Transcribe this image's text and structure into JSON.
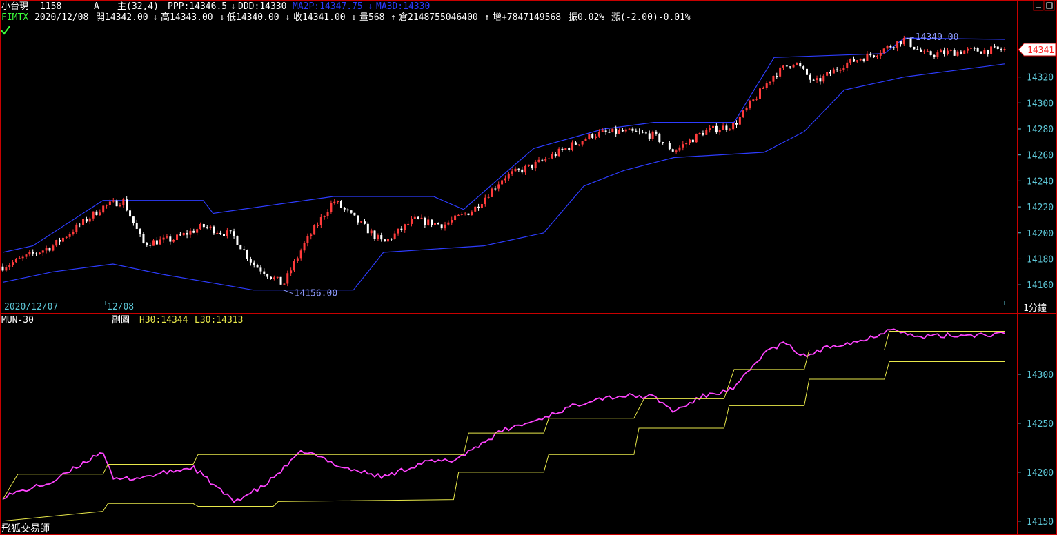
{
  "header": {
    "name": "小台現",
    "time": "1158",
    "flag": "A",
    "main_params": "主(32,4)",
    "ppp": "PPP:14346.5",
    "ppp_arrow": "↓",
    "ddd": "DDD:14330",
    "ma2p": "MA2P:14347.75",
    "ma2p_arrow": "↓",
    "ma3d": "MA3D:14330",
    "symbol": "FIMTX",
    "date": "2020/12/08",
    "open": "開14342.00",
    "open_arrow": "↓",
    "high": "高14343.00",
    "high_arrow": "↓",
    "low": "低14340.00",
    "low_arrow": "↓",
    "close": "收14341.00",
    "close_arrow": "↓",
    "volume": "量568",
    "volume_arrow": "↑",
    "oi": "倉2148755046400",
    "oi_arrow": "↑",
    "oi_change": "增+7847149568",
    "amplitude": "振0.02%",
    "change": "漲(-2.00)-0.01%"
  },
  "price_tag": "14341",
  "timeline": {
    "left_date": "2020/12/07",
    "mid_date": "12/08",
    "period": "1分鐘"
  },
  "sub_header": {
    "name": "MUN-30",
    "label": "副圖",
    "h30": "H30:14344",
    "l30": "L30:14313"
  },
  "watermark": "飛狐交易師",
  "colors": {
    "up_candle": "#ff3b3b",
    "down_candle": "#ffffff",
    "upper_band": "#2d3cff",
    "lower_band": "#2d3cff",
    "axis_text": "#5ec8d8",
    "frame": "#c80000",
    "mun_line": "#ff44ff",
    "h30_line": "#e8e84a",
    "l30_line": "#e8e84a"
  },
  "chart_data": [
    {
      "type": "candlestick",
      "title": "FIMTX 1分鐘",
      "ylim": [
        14150,
        14358
      ],
      "y_ticks": [
        14160,
        14180,
        14200,
        14220,
        14240,
        14260,
        14280,
        14300,
        14320
      ],
      "annotations": [
        {
          "text": "14349.00",
          "value": 14349,
          "position": "high"
        },
        {
          "text": "14156.00",
          "value": 14156,
          "position": "low"
        }
      ],
      "anchors": [
        {
          "t": 0,
          "v": 14174
        },
        {
          "t": 0.05,
          "v": 14190
        },
        {
          "t": 0.1,
          "v": 14220
        },
        {
          "t": 0.12,
          "v": 14225
        },
        {
          "t": 0.14,
          "v": 14192
        },
        {
          "t": 0.17,
          "v": 14195
        },
        {
          "t": 0.2,
          "v": 14205
        },
        {
          "t": 0.23,
          "v": 14198
        },
        {
          "t": 0.25,
          "v": 14176
        },
        {
          "t": 0.28,
          "v": 14160
        },
        {
          "t": 0.3,
          "v": 14190
        },
        {
          "t": 0.33,
          "v": 14225
        },
        {
          "t": 0.36,
          "v": 14205
        },
        {
          "t": 0.38,
          "v": 14192
        },
        {
          "t": 0.41,
          "v": 14210
        },
        {
          "t": 0.44,
          "v": 14206
        },
        {
          "t": 0.47,
          "v": 14218
        },
        {
          "t": 0.5,
          "v": 14243
        },
        {
          "t": 0.53,
          "v": 14252
        },
        {
          "t": 0.56,
          "v": 14264
        },
        {
          "t": 0.59,
          "v": 14276
        },
        {
          "t": 0.62,
          "v": 14278
        },
        {
          "t": 0.65,
          "v": 14275
        },
        {
          "t": 0.67,
          "v": 14263
        },
        {
          "t": 0.7,
          "v": 14278
        },
        {
          "t": 0.73,
          "v": 14283
        },
        {
          "t": 0.77,
          "v": 14322
        },
        {
          "t": 0.79,
          "v": 14332
        },
        {
          "t": 0.81,
          "v": 14315
        },
        {
          "t": 0.84,
          "v": 14330
        },
        {
          "t": 0.87,
          "v": 14338
        },
        {
          "t": 0.9,
          "v": 14349
        },
        {
          "t": 0.92,
          "v": 14337
        },
        {
          "t": 0.96,
          "v": 14340
        },
        {
          "t": 1,
          "v": 14341
        }
      ],
      "upper_band": [
        {
          "t": 0,
          "v": 14185
        },
        {
          "t": 0.03,
          "v": 14190
        },
        {
          "t": 0.1,
          "v": 14225
        },
        {
          "t": 0.2,
          "v": 14225
        },
        {
          "t": 0.21,
          "v": 14215
        },
        {
          "t": 0.33,
          "v": 14228
        },
        {
          "t": 0.43,
          "v": 14228
        },
        {
          "t": 0.46,
          "v": 14218
        },
        {
          "t": 0.5,
          "v": 14245
        },
        {
          "t": 0.53,
          "v": 14265
        },
        {
          "t": 0.6,
          "v": 14280
        },
        {
          "t": 0.65,
          "v": 14285
        },
        {
          "t": 0.73,
          "v": 14285
        },
        {
          "t": 0.77,
          "v": 14335
        },
        {
          "t": 0.88,
          "v": 14338
        },
        {
          "t": 0.9,
          "v": 14350
        },
        {
          "t": 1,
          "v": 14349
        }
      ],
      "lower_band": [
        {
          "t": 0,
          "v": 14162
        },
        {
          "t": 0.05,
          "v": 14170
        },
        {
          "t": 0.11,
          "v": 14176
        },
        {
          "t": 0.16,
          "v": 14168
        },
        {
          "t": 0.25,
          "v": 14156
        },
        {
          "t": 0.35,
          "v": 14156
        },
        {
          "t": 0.38,
          "v": 14185
        },
        {
          "t": 0.48,
          "v": 14190
        },
        {
          "t": 0.54,
          "v": 14200
        },
        {
          "t": 0.58,
          "v": 14236
        },
        {
          "t": 0.62,
          "v": 14248
        },
        {
          "t": 0.67,
          "v": 14258
        },
        {
          "t": 0.76,
          "v": 14262
        },
        {
          "t": 0.8,
          "v": 14278
        },
        {
          "t": 0.84,
          "v": 14310
        },
        {
          "t": 0.9,
          "v": 14320
        },
        {
          "t": 1,
          "v": 14330
        }
      ]
    },
    {
      "type": "line",
      "title": "MUN-30",
      "ylim": [
        14140,
        14350
      ],
      "y_ticks": [
        14150,
        14200,
        14250,
        14300
      ],
      "series": [
        {
          "name": "MUN",
          "points": [
            {
              "t": 0,
              "v": 14175
            },
            {
              "t": 0.05,
              "v": 14190
            },
            {
              "t": 0.1,
              "v": 14222
            },
            {
              "t": 0.11,
              "v": 14192
            },
            {
              "t": 0.14,
              "v": 14195
            },
            {
              "t": 0.19,
              "v": 14205
            },
            {
              "t": 0.23,
              "v": 14170
            },
            {
              "t": 0.26,
              "v": 14185
            },
            {
              "t": 0.3,
              "v": 14222
            },
            {
              "t": 0.34,
              "v": 14205
            },
            {
              "t": 0.38,
              "v": 14195
            },
            {
              "t": 0.42,
              "v": 14210
            },
            {
              "t": 0.45,
              "v": 14212
            },
            {
              "t": 0.5,
              "v": 14243
            },
            {
              "t": 0.53,
              "v": 14252
            },
            {
              "t": 0.56,
              "v": 14264
            },
            {
              "t": 0.59,
              "v": 14275
            },
            {
              "t": 0.62,
              "v": 14278
            },
            {
              "t": 0.65,
              "v": 14277
            },
            {
              "t": 0.67,
              "v": 14262
            },
            {
              "t": 0.7,
              "v": 14278
            },
            {
              "t": 0.73,
              "v": 14285
            },
            {
              "t": 0.76,
              "v": 14322
            },
            {
              "t": 0.78,
              "v": 14332
            },
            {
              "t": 0.8,
              "v": 14318
            },
            {
              "t": 0.83,
              "v": 14330
            },
            {
              "t": 0.86,
              "v": 14335
            },
            {
              "t": 0.89,
              "v": 14348
            },
            {
              "t": 0.91,
              "v": 14338
            },
            {
              "t": 0.95,
              "v": 14340
            },
            {
              "t": 1,
              "v": 14341
            }
          ]
        },
        {
          "name": "H30",
          "points": [
            {
              "t": 0,
              "v": 14172
            },
            {
              "t": 0.015,
              "v": 14198
            },
            {
              "t": 0.1,
              "v": 14198
            },
            {
              "t": 0.105,
              "v": 14208
            },
            {
              "t": 0.19,
              "v": 14208
            },
            {
              "t": 0.195,
              "v": 14218
            },
            {
              "t": 0.46,
              "v": 14218
            },
            {
              "t": 0.465,
              "v": 14240
            },
            {
              "t": 0.54,
              "v": 14240
            },
            {
              "t": 0.545,
              "v": 14255
            },
            {
              "t": 0.63,
              "v": 14255
            },
            {
              "t": 0.64,
              "v": 14275
            },
            {
              "t": 0.72,
              "v": 14275
            },
            {
              "t": 0.73,
              "v": 14305
            },
            {
              "t": 0.8,
              "v": 14305
            },
            {
              "t": 0.805,
              "v": 14325
            },
            {
              "t": 0.88,
              "v": 14325
            },
            {
              "t": 0.885,
              "v": 14344
            },
            {
              "t": 1,
              "v": 14344
            }
          ]
        },
        {
          "name": "L30",
          "points": [
            {
              "t": 0,
              "v": 14150
            },
            {
              "t": 0.1,
              "v": 14160
            },
            {
              "t": 0.105,
              "v": 14168
            },
            {
              "t": 0.19,
              "v": 14168
            },
            {
              "t": 0.195,
              "v": 14165
            },
            {
              "t": 0.27,
              "v": 14165
            },
            {
              "t": 0.275,
              "v": 14170
            },
            {
              "t": 0.45,
              "v": 14172
            },
            {
              "t": 0.455,
              "v": 14200
            },
            {
              "t": 0.54,
              "v": 14200
            },
            {
              "t": 0.545,
              "v": 14218
            },
            {
              "t": 0.63,
              "v": 14218
            },
            {
              "t": 0.635,
              "v": 14245
            },
            {
              "t": 0.72,
              "v": 14245
            },
            {
              "t": 0.725,
              "v": 14268
            },
            {
              "t": 0.8,
              "v": 14268
            },
            {
              "t": 0.805,
              "v": 14295
            },
            {
              "t": 0.88,
              "v": 14295
            },
            {
              "t": 0.885,
              "v": 14313
            },
            {
              "t": 1,
              "v": 14313
            }
          ]
        }
      ]
    }
  ]
}
